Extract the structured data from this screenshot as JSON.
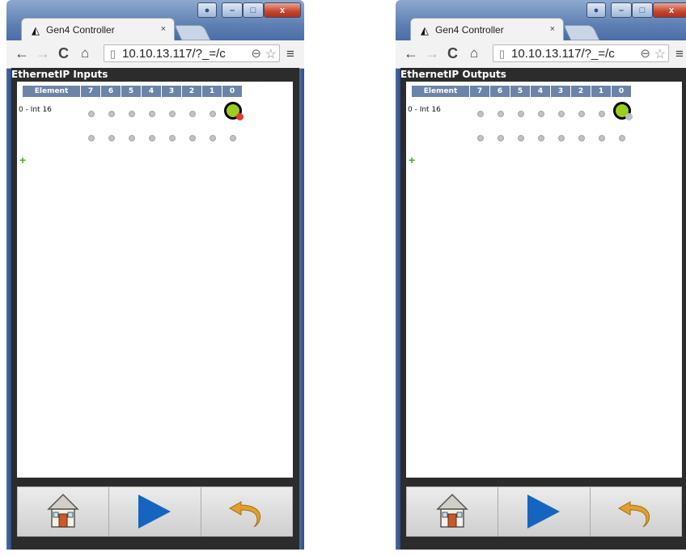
{
  "windows": [
    {
      "tab_title": "Gen4 Controller",
      "tab_close": "×",
      "url": "10.10.13.117/?_=/c",
      "menu": "≡",
      "page_title": "EthernetIP Inputs",
      "columns": [
        "Element",
        "7",
        "6",
        "5",
        "4",
        "3",
        "2",
        "1",
        "0"
      ],
      "row_label": "0 - Int 16",
      "bit0_indicator_color": "#e53935",
      "add_label": "+"
    },
    {
      "tab_title": "Gen4 Controller",
      "tab_close": "×",
      "url": "10.10.13.117/?_=/c",
      "menu": "≡",
      "page_title": "EthernetIP Outputs",
      "columns": [
        "Element",
        "7",
        "6",
        "5",
        "4",
        "3",
        "2",
        "1",
        "0"
      ],
      "row_label": "0 - Int 16",
      "bit0_indicator_color": "#bdbdbd",
      "add_label": "+"
    }
  ],
  "window_controls": {
    "minimize": "–",
    "maximize": "□",
    "close": "x"
  },
  "nav_icons": [
    "back-arrow-icon",
    "forward-arrow-icon",
    "reload-icon",
    "home-icon"
  ],
  "bottom_buttons": [
    "home-button",
    "play-button",
    "undo-button"
  ],
  "colors": {
    "accent_green": "#9ccc1e",
    "header_blue": "#6b84a8",
    "play_blue": "#1565c0",
    "undo_orange": "#e0a030"
  }
}
